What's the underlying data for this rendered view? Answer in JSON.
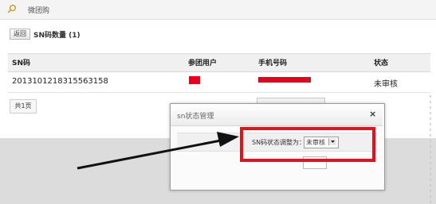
{
  "breadcrumb": {
    "title": "微团购"
  },
  "toolbar": {
    "back_label": "返回",
    "count_label": "SN码数量 (1)"
  },
  "table": {
    "columns": [
      "SN码",
      "参团用户",
      "手机号码",
      "状态"
    ],
    "rows": [
      {
        "sn": "2013101218315563158",
        "user": "",
        "phone": "",
        "status": "未审核"
      }
    ]
  },
  "pager": {
    "label": "共1页"
  },
  "dialog": {
    "title": "sn状态管理",
    "close": "×",
    "field_label": "SN码状态调整为：",
    "select_value": "未审核"
  },
  "colors": {
    "highlight": "#e0141e",
    "redaction": "#e8001c"
  }
}
